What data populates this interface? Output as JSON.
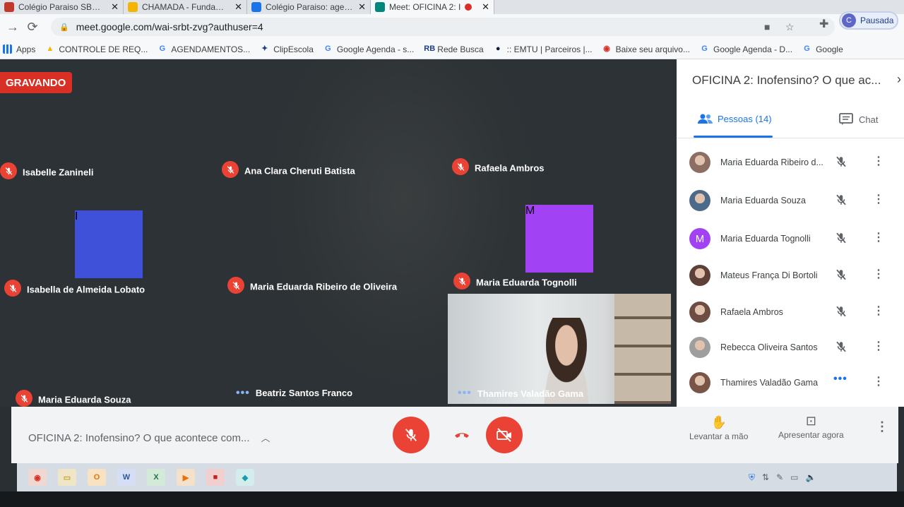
{
  "browser": {
    "tabs": [
      {
        "title": "Colégio Paraiso SBC - E",
        "favicon_color": "#c0392b",
        "active": false
      },
      {
        "title": "CHAMADA - Fundamen",
        "favicon_color": "#f4b400",
        "active": false
      },
      {
        "title": "Colégio Paraiso: agend",
        "favicon_color": "#1a73e8",
        "active": false
      },
      {
        "title": "Meet: OFICINA 2: I",
        "favicon_color": "#00897b",
        "active": true
      }
    ],
    "url": "meet.google.com/wai-srbt-zvg?authuser=4",
    "profile": {
      "initial": "C",
      "status": "Pausada"
    },
    "bookmarks": [
      {
        "label": "Apps",
        "icon": "apps-grid-icon",
        "color": "#1a73e8",
        "glyph": ""
      },
      {
        "label": "CONTROLE DE REQ...",
        "icon": "drive-icon",
        "color": "#f4b400",
        "glyph": "▲"
      },
      {
        "label": "AGENDAMENTOS...",
        "icon": "google-icon",
        "color": "#4285f4",
        "glyph": "G"
      },
      {
        "label": "ClipEscola",
        "icon": "clipescola-icon",
        "color": "#1a3e8a",
        "glyph": "✦"
      },
      {
        "label": "Google Agenda - s...",
        "icon": "google-icon",
        "color": "#4285f4",
        "glyph": "G"
      },
      {
        "label": "Rede Busca",
        "icon": "rb-icon",
        "color": "#1a3e8a",
        "glyph": "RB"
      },
      {
        "label": ":: EMTU | Parceiros |...",
        "icon": "emtu-icon",
        "color": "#0d1b4c",
        "glyph": "●"
      },
      {
        "label": "Baixe seu arquivo...",
        "icon": "download-icon",
        "color": "#d93025",
        "glyph": "◉"
      },
      {
        "label": "Google Agenda - D...",
        "icon": "google-icon",
        "color": "#4285f4",
        "glyph": "G"
      },
      {
        "label": "Google",
        "icon": "google-icon",
        "color": "#4285f4",
        "glyph": "G"
      }
    ]
  },
  "meet": {
    "recording_label": "GRAVANDO",
    "tiles": [
      {
        "name": "Isabelle Zanineli",
        "kind": "photo",
        "mic": "muted"
      },
      {
        "name": "Ana Clara Cheruti Batista",
        "kind": "photo",
        "mic": "muted"
      },
      {
        "name": "Rafaela Ambros",
        "kind": "photo",
        "mic": "muted"
      },
      {
        "name": "Isabella de Almeida Lobato",
        "kind": "letter",
        "letter": "I",
        "color": "#3f51d8",
        "mic": "muted"
      },
      {
        "name": "Maria Eduarda Ribeiro de Oliveira",
        "kind": "photo",
        "mic": "muted"
      },
      {
        "name": "Maria Eduarda Tognolli",
        "kind": "letter",
        "letter": "M",
        "color": "#a142f4",
        "mic": "muted"
      },
      {
        "name": "Maria Eduarda Souza",
        "kind": "photo",
        "mic": "muted"
      },
      {
        "name": "Beatriz Santos Franco",
        "kind": "photo",
        "mic": "speaking"
      }
    ],
    "video_tile": {
      "name": "Thamires Valadão Gama"
    },
    "meeting_title": "OFICINA 2: Inofensino? O que acontece com...",
    "controls": {
      "raise_hand": "Levantar a mão",
      "present": "Apresentar agora"
    }
  },
  "panel": {
    "title": "OFICINA 2: Inofensino? O que ac...",
    "people_tab": "Pessoas (14)",
    "chat_tab": "Chat",
    "people": [
      {
        "name": "Maria Eduarda Ribeiro d...",
        "avatar": "photo",
        "color": "#8d6e63",
        "mic": "muted"
      },
      {
        "name": "Maria Eduarda Souza",
        "avatar": "photo",
        "color": "#4e6a8a",
        "mic": "muted"
      },
      {
        "name": "Maria Eduarda Tognolli",
        "avatar": "letter",
        "letter": "M",
        "color": "#a142f4",
        "mic": "muted"
      },
      {
        "name": "Mateus França Di Bortoli",
        "avatar": "photo",
        "color": "#5d4037",
        "mic": "muted"
      },
      {
        "name": "Rafaela Ambros",
        "avatar": "photo",
        "color": "#6d4c41",
        "mic": "muted"
      },
      {
        "name": "Rebecca Oliveira Santos",
        "avatar": "photo",
        "color": "#9e9e9e",
        "mic": "muted"
      },
      {
        "name": "Thamires Valadão Gama",
        "avatar": "photo",
        "color": "#795548",
        "mic": "speaking"
      }
    ]
  },
  "colors": {
    "danger": "#ea4335",
    "accent": "#1a73e8",
    "recording": "#d93025"
  }
}
